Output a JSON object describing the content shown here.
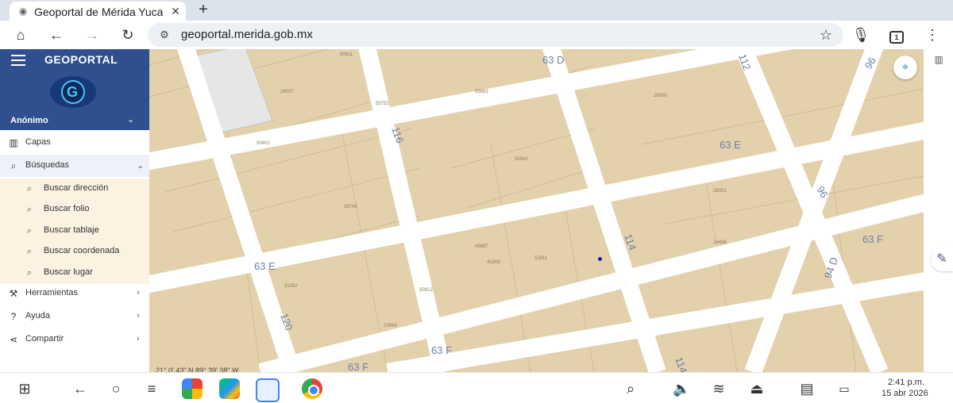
{
  "browser": {
    "tab_title": "Geoportal de Mérida Yuca",
    "tab_close": "✕",
    "new_tab": "+",
    "url": "geoportal.merida.gob.mx",
    "tab_count": "1"
  },
  "sidebar": {
    "brand": "GEOPORTAL",
    "user": "Anónimo",
    "items": [
      {
        "label": "Capas",
        "icon": "map-icon"
      },
      {
        "label": "Búsquedas",
        "icon": "search-icon"
      },
      {
        "label": "Herramientas",
        "icon": "tools-icon"
      },
      {
        "label": "Ayuda",
        "icon": "help-icon"
      },
      {
        "label": "Compartir",
        "icon": "share-icon"
      }
    ],
    "search_items": [
      {
        "label": "Buscar dirección"
      },
      {
        "label": "Buscar folio"
      },
      {
        "label": "Buscar tablaje"
      },
      {
        "label": "Buscar coordenada"
      },
      {
        "label": "Buscar lugar"
      }
    ]
  },
  "map": {
    "streets": [
      "63 D",
      "63 E",
      "63 E",
      "63 F",
      "63 F",
      "63 F",
      "116",
      "114",
      "114",
      "120",
      "96",
      "96",
      "94 D",
      "112"
    ],
    "coords": "21° 0' 43\" N 89° 39' 38\" W",
    "lots": [
      "50611",
      "26037",
      "55752",
      "50401",
      "52940",
      "28743",
      "55863",
      "31052",
      "23944",
      "26006",
      "28051",
      "52811",
      "41909",
      "50812",
      "49887",
      "24488"
    ],
    "parcel_color": "#e3d1ac",
    "road_color": "#ffffff",
    "accent": "#2f4f8f"
  },
  "taskbar": {
    "time": "2:41 p.m.",
    "date": "15 abr 2026"
  }
}
